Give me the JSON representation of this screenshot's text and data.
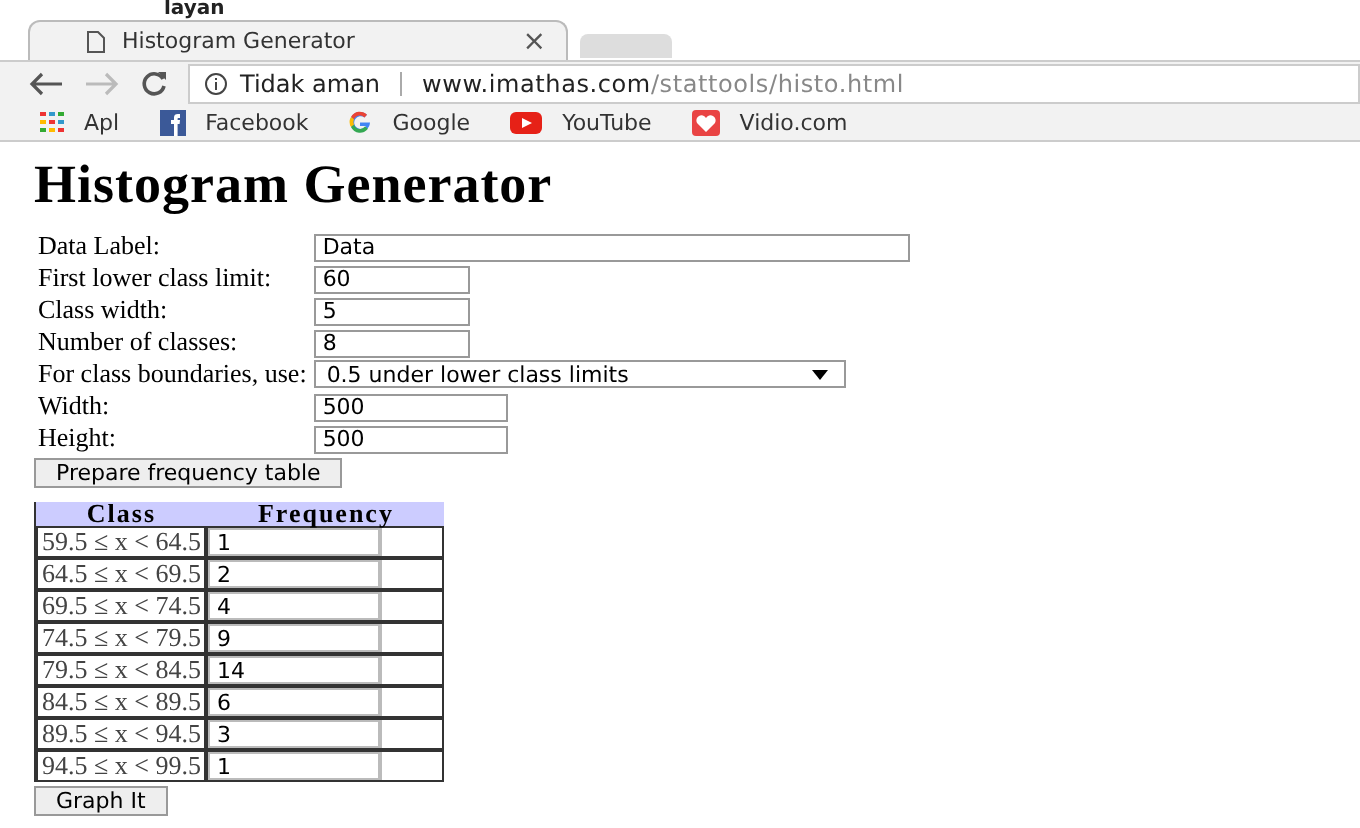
{
  "top_fragment": "layan",
  "tab": {
    "title": "Histogram Generator",
    "close": "×"
  },
  "address": {
    "security": "Tidak aman",
    "host": "www.imathas.com",
    "path": "/stattools/histo.html"
  },
  "bookmarks": [
    {
      "label": "Apl",
      "kind": "apps"
    },
    {
      "label": "Facebook",
      "kind": "facebook"
    },
    {
      "label": "Google",
      "kind": "google"
    },
    {
      "label": "YouTube",
      "kind": "youtube"
    },
    {
      "label": "Vidio.com",
      "kind": "vidio"
    }
  ],
  "heading": "Histogram Generator",
  "form": [
    {
      "label": "Data Label:",
      "value": "Data",
      "kind": "wide"
    },
    {
      "label": "First lower class limit:",
      "value": "60",
      "kind": "short"
    },
    {
      "label": "Class width:",
      "value": "5",
      "kind": "short"
    },
    {
      "label": "Number of classes:",
      "value": "8",
      "kind": "short"
    },
    {
      "label": "For class boundaries, use:",
      "value": "0.5 under lower class limits",
      "kind": "select"
    },
    {
      "label": "Width:",
      "value": "500",
      "kind": "medium"
    },
    {
      "label": "Height:",
      "value": "500",
      "kind": "medium"
    }
  ],
  "prepare_button": "Prepare frequency table",
  "table": {
    "columns": [
      "Class",
      "Frequency"
    ],
    "rows": [
      {
        "class": "59.5 ≤ x < 64.5",
        "frequency": "1"
      },
      {
        "class": "64.5 ≤ x < 69.5",
        "frequency": "2"
      },
      {
        "class": "69.5 ≤ x < 74.5",
        "frequency": "4"
      },
      {
        "class": "74.5 ≤ x < 79.5",
        "frequency": "9"
      },
      {
        "class": "79.5 ≤ x < 84.5",
        "frequency": "14"
      },
      {
        "class": "84.5 ≤ x < 89.5",
        "frequency": "6"
      },
      {
        "class": "89.5 ≤ x < 94.5",
        "frequency": "3"
      },
      {
        "class": "94.5 ≤ x < 99.5",
        "frequency": "1"
      }
    ]
  },
  "graph_button": "Graph It"
}
